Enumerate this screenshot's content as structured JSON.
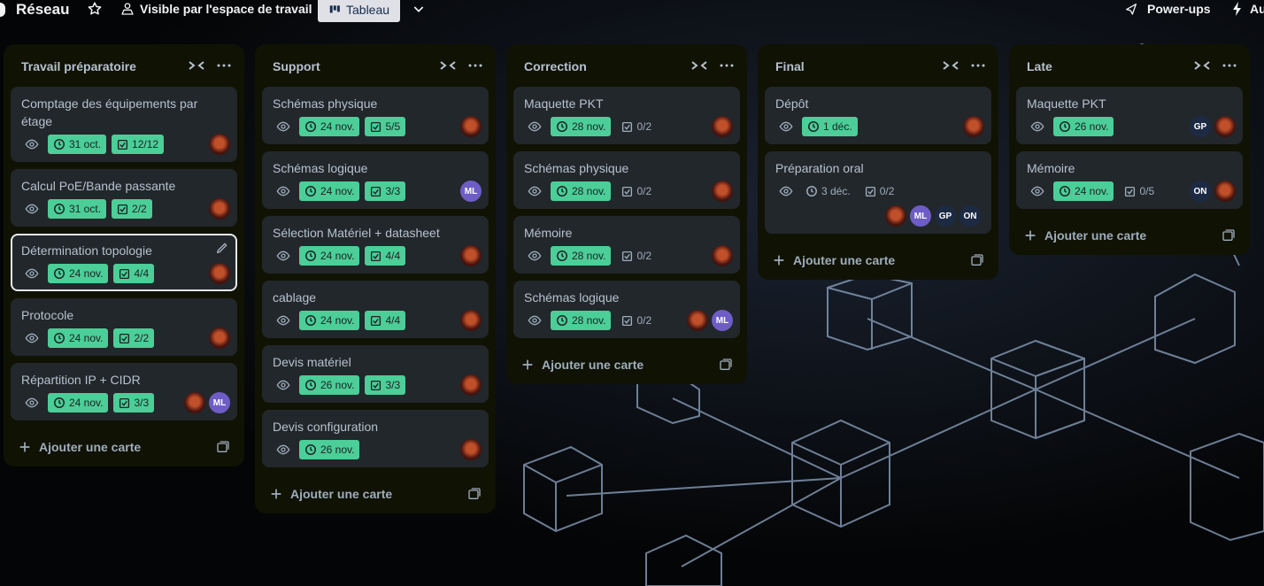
{
  "topbar": {
    "board_title": "Réseau",
    "visibility": "Visible par l'espace de travail",
    "view": "Tableau",
    "powerups": "Power-ups",
    "automation": "Au"
  },
  "add_card_label": "Ajouter une carte",
  "lists": [
    {
      "title": "Travail préparatoire",
      "cards": [
        {
          "title": "Comptage des équipements par étage",
          "date": "31 oct.",
          "check": "12/12"
        },
        {
          "title": "Calcul PoE/Bande passante",
          "date": "31 oct.",
          "check": "2/2"
        },
        {
          "title": "Détermination topologie",
          "date": "24 nov.",
          "check": "4/4"
        },
        {
          "title": "Protocole",
          "date": "24 nov.",
          "check": "2/2"
        },
        {
          "title": "Répartition IP + CIDR",
          "date": "24 nov.",
          "check": "3/3",
          "members": [
            "ML"
          ]
        }
      ]
    },
    {
      "title": "Support",
      "cards": [
        {
          "title": "Schémas physique",
          "date": "24 nov.",
          "check": "5/5"
        },
        {
          "title": "Schémas logique",
          "date": "24 nov.",
          "check": "3/3",
          "members": [
            "ML"
          ]
        },
        {
          "title": "Sélection Matériel + datasheet",
          "date": "24 nov.",
          "check": "4/4"
        },
        {
          "title": "cablage",
          "date": "24 nov.",
          "check": "4/4"
        },
        {
          "title": "Devis matériel",
          "date": "26 nov.",
          "check": "3/3"
        },
        {
          "title": "Devis configuration",
          "date": "26 nov."
        }
      ]
    },
    {
      "title": "Correction",
      "cards": [
        {
          "title": "Maquette PKT",
          "date": "28 nov.",
          "check": "0/2"
        },
        {
          "title": "Schémas physique",
          "date": "28 nov.",
          "check": "0/2"
        },
        {
          "title": "Mémoire",
          "date": "28 nov.",
          "check": "0/2"
        },
        {
          "title": "Schémas logique",
          "date": "28 nov.",
          "check": "0/2",
          "members": [
            "ML"
          ]
        }
      ]
    },
    {
      "title": "Final",
      "cards": [
        {
          "title": "Dépôt",
          "date": "1 déc."
        },
        {
          "title": "Préparation oral",
          "date": "3 déc.",
          "check": "0/2",
          "members": [
            "ML",
            "GP",
            "ON"
          ]
        }
      ]
    },
    {
      "title": "Late",
      "cards": [
        {
          "title": "Maquette PKT",
          "date": "26 nov.",
          "members": [
            "GP"
          ]
        },
        {
          "title": "Mémoire",
          "date": "24 nov.",
          "check": "0/5",
          "members": [
            "ON"
          ]
        }
      ]
    }
  ]
}
